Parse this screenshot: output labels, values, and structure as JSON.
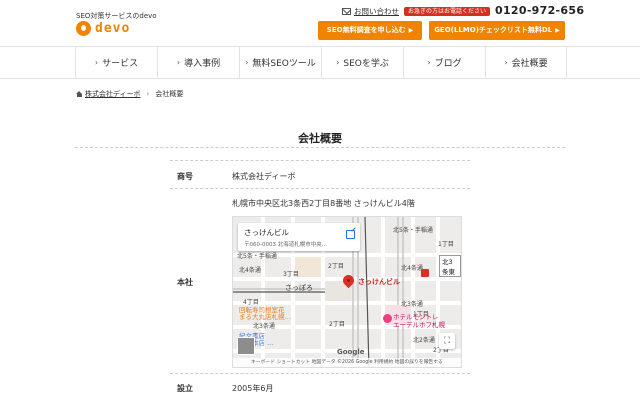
{
  "header": {
    "tagline": "SEO対策サービスのdevo",
    "logo_text": "devo",
    "contact_label": "お問い合わせ",
    "phone_badge": "お急ぎの方はお電話ください",
    "phone_number": "0120-972-656",
    "cta_primary": "SEO無料調査を申し込む",
    "cta_secondary": "GEO(LLMO)チェックリスト無料DL",
    "cta_arrow": "▶",
    "brand_color": "#f08300"
  },
  "nav": {
    "chevron": "›",
    "items": [
      {
        "label": "サービス"
      },
      {
        "label": "導入事例"
      },
      {
        "label": "無料SEOツール"
      },
      {
        "label": "SEOを学ぶ"
      },
      {
        "label": "ブログ"
      },
      {
        "label": "会社概要"
      }
    ]
  },
  "breadcrumb": {
    "home": "株式会社ディーボ",
    "separator": "›",
    "current": "会社概要"
  },
  "page": {
    "title": "会社概要"
  },
  "company_table": {
    "rows": [
      {
        "label": "商号",
        "value": "株式会社ディーボ"
      },
      {
        "label": "本社",
        "value": "札幌市中央区北3条西2丁目8番地 さっけんビル4階"
      },
      {
        "label": "設立",
        "value": "2005年6月"
      }
    ]
  },
  "map": {
    "place_name": "さっけんビル",
    "place_address": "〒060-0003 北海道札幌市中央...",
    "pin_label": "さっけんビル",
    "station": "さっぽろ",
    "hotel": "ホテルモントレ\nエーデルホフ札幌",
    "building1": "回転寿司根室花\nまる大丸店札幌…",
    "building2": "紀文書店\n札幌本店 ...",
    "district": "北3条東",
    "fullscreen": "⛶",
    "google": "Google",
    "attribution": "キーボード ショートカット   地図データ ©2026 Google   利用規約   地図の誤りを報告する",
    "streets": [
      "北5条・手稲通",
      "北5条・手稲通",
      "北4条通",
      "北3条通",
      "北2条通",
      "北4条通",
      "北3条通",
      "2丁目",
      "3丁目",
      "4丁目",
      "2丁目",
      "1丁目",
      "1丁目",
      "2丁目"
    ]
  }
}
